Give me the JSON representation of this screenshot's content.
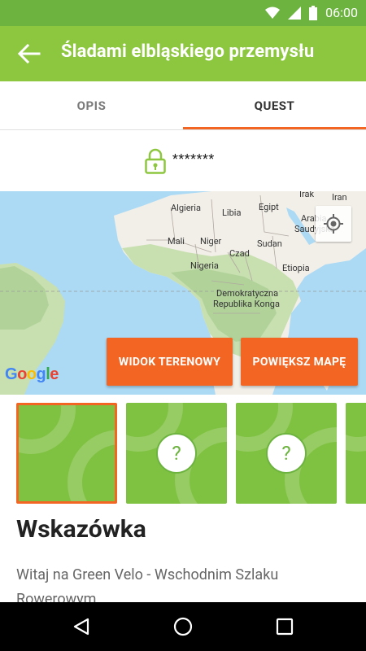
{
  "status_bar": {
    "time": "06:00",
    "icons": [
      "wifi-icon",
      "signal-icon",
      "battery-icon"
    ]
  },
  "app_bar": {
    "title": "Śladami elbląskiego przemysłu",
    "back_icon": "arrow-back-icon"
  },
  "tabs": [
    {
      "label": "OPIS",
      "active": false
    },
    {
      "label": "QUEST",
      "active": true
    }
  ],
  "password": {
    "icon": "lock-icon",
    "value": "*******"
  },
  "map": {
    "labels": [
      "Algieria",
      "Libia",
      "Egipt",
      "Irak",
      "Iran",
      "Arabia",
      "Saudyjska",
      "Mali",
      "Niger",
      "Sudan",
      "Czad",
      "Nigeria",
      "Etiopia",
      "Demokratyczna",
      "Republika Konga"
    ],
    "logo": "Google",
    "location_icon": "my-location-icon"
  },
  "buttons": {
    "terrain": "WIDOK TERENOWY",
    "enlarge": "POWIĘKSZ MAPĘ"
  },
  "thumbnails": [
    {
      "selected": true,
      "locked": false
    },
    {
      "selected": false,
      "locked": true,
      "mark": "?"
    },
    {
      "selected": false,
      "locked": true,
      "mark": "?"
    },
    {
      "selected": false,
      "locked": true
    }
  ],
  "hint": {
    "title": "Wskazówka",
    "text": "Witaj na Green Velo - Wschodnim Szlaku Rowerowym"
  },
  "colors": {
    "status_bar": "#6cb33f",
    "app_bar": "#8dc63f",
    "accent": "#f26522",
    "thumbnail": "#7fc141"
  }
}
